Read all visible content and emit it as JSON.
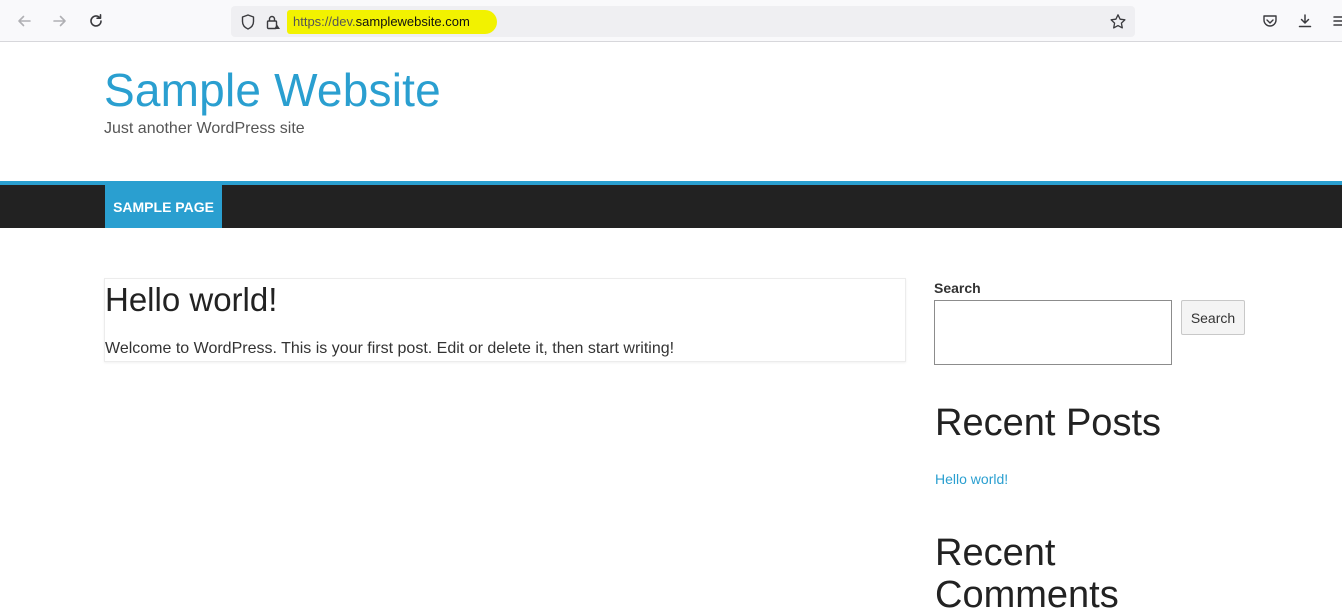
{
  "browser": {
    "url_scheme": "https://dev.",
    "url_host": "samplewebsite.com",
    "highlight_color": "#f2f200"
  },
  "site": {
    "title": "Sample Website",
    "tagline": "Just another WordPress site",
    "accent_color": "#2a9fd0",
    "nav_bar_color": "#222222"
  },
  "nav": {
    "items": [
      {
        "label": "SAMPLE PAGE"
      }
    ]
  },
  "post": {
    "title": "Hello world!",
    "body": "Welcome to WordPress. This is your first post. Edit or delete it, then start writing!"
  },
  "sidebar": {
    "search_label": "Search",
    "search_value": "",
    "search_button": "Search",
    "recent_posts_heading": "Recent Posts",
    "recent_posts": [
      {
        "label": "Hello world!"
      }
    ],
    "recent_comments_heading_line1": "Recent",
    "recent_comments_heading_line2": "Comments"
  }
}
